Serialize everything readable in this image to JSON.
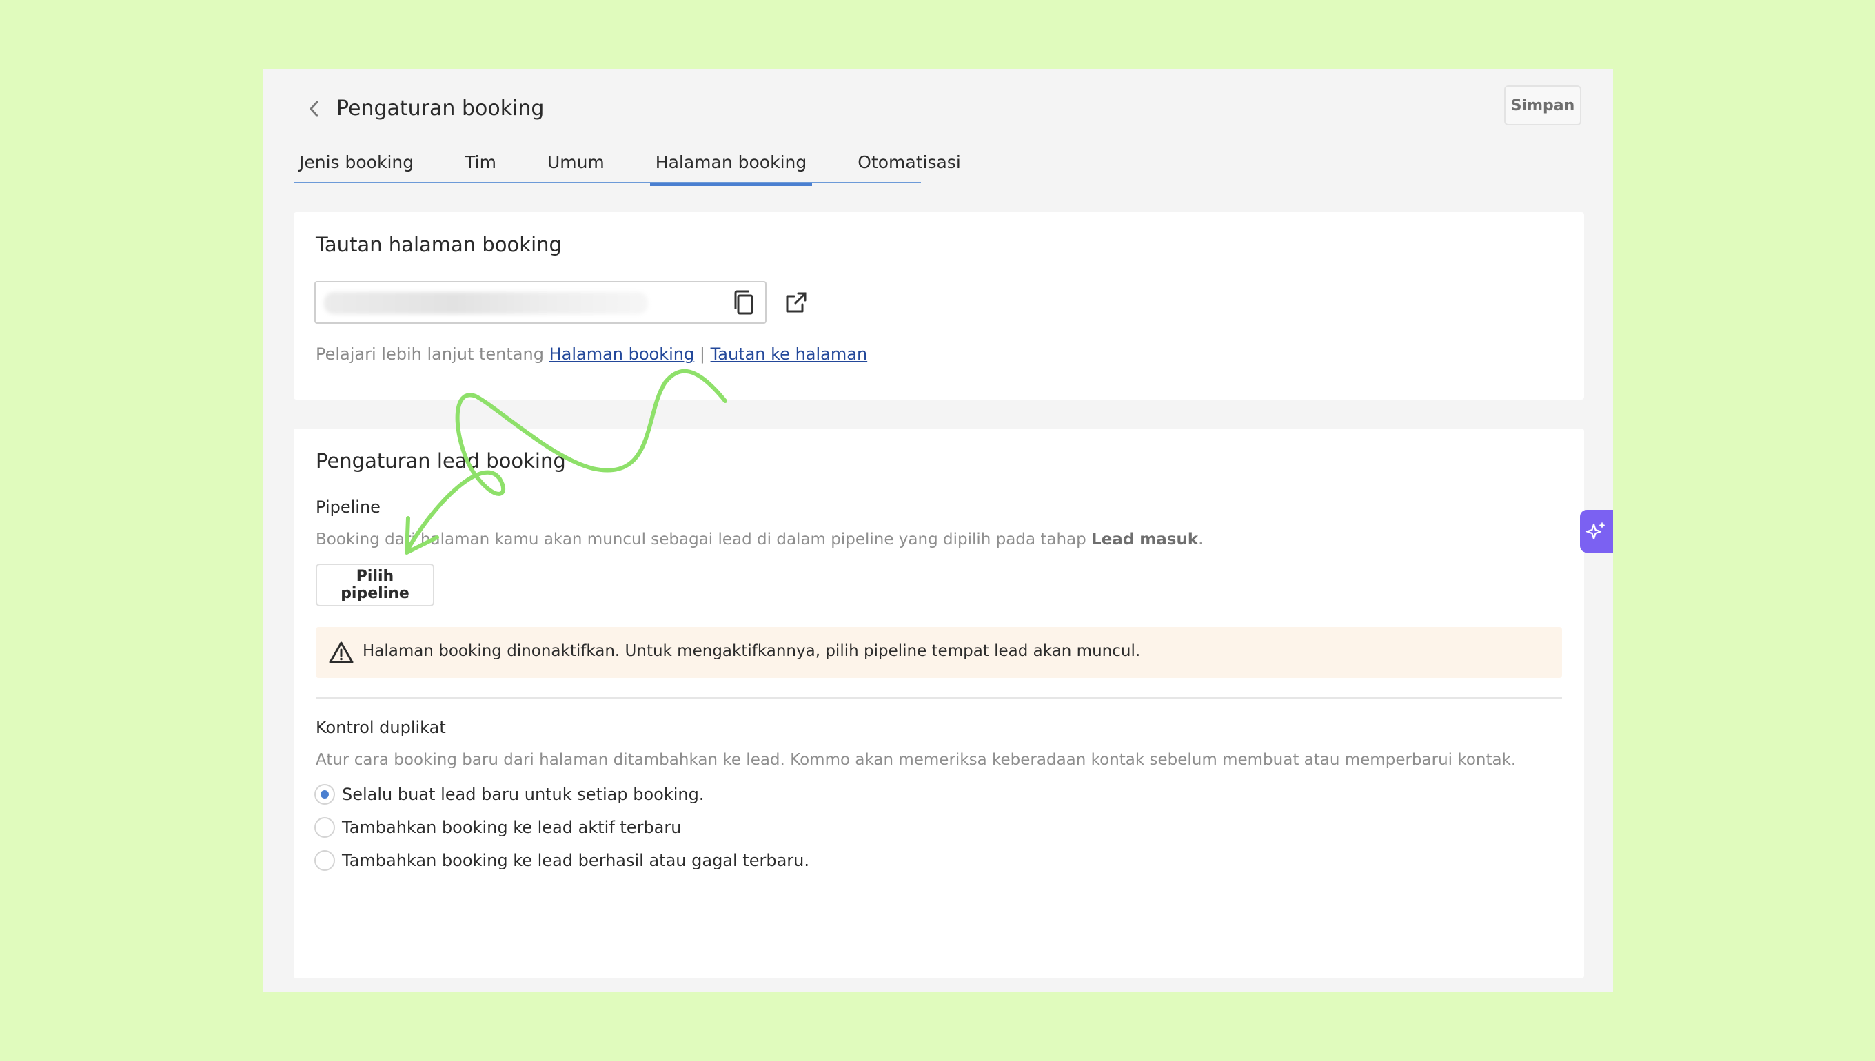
{
  "header": {
    "title": "Pengaturan booking",
    "save_label": "Simpan"
  },
  "tabs": [
    {
      "label": "Jenis booking",
      "active": false
    },
    {
      "label": "Tim",
      "active": false
    },
    {
      "label": "Umum",
      "active": false
    },
    {
      "label": "Halaman booking",
      "active": true
    },
    {
      "label": "Otomatisasi",
      "active": false
    }
  ],
  "link_card": {
    "title": "Tautan halaman booking",
    "url_value": "",
    "learn_prefix": "Pelajari lebih lanjut tentang ",
    "link1": "Halaman booking",
    "separator": " | ",
    "link2": "Tautan ke halaman"
  },
  "lead_card": {
    "title": "Pengaturan lead booking",
    "pipeline_label": "Pipeline",
    "pipeline_desc_prefix": "Booking dari halaman kamu akan muncul sebagai lead di dalam pipeline yang dipilih pada tahap ",
    "pipeline_desc_bold": "Lead masuk",
    "pipeline_desc_suffix": ".",
    "pipeline_button": "Pilih pipeline",
    "warning": "Halaman booking dinonaktifkan. Untuk mengaktifkannya, pilih pipeline tempat lead akan muncul.",
    "duplicate_label": "Kontrol duplikat",
    "duplicate_desc": "Atur cara booking baru dari halaman ditambahkan ke lead. Kommo akan memeriksa keberadaan kontak sebelum membuat atau memperbarui kontak.",
    "options": [
      {
        "label": "Selalu buat lead baru untuk setiap booking.",
        "checked": true
      },
      {
        "label": "Tambahkan booking ke lead aktif terbaru",
        "checked": false
      },
      {
        "label": "Tambahkan booking ke lead berhasil atau gagal terbaru.",
        "checked": false
      }
    ]
  },
  "colors": {
    "background": "#e0fbbd",
    "accent": "#4a7fd0",
    "ai_button": "#7b61f2",
    "annotation": "#8ee06a",
    "warning_bg": "#fdf4ea"
  },
  "icons": {
    "back": "chevron-left-icon",
    "copy": "copy-icon",
    "open": "external-link-icon",
    "warning": "warning-triangle-icon",
    "ai": "sparkles-icon"
  }
}
